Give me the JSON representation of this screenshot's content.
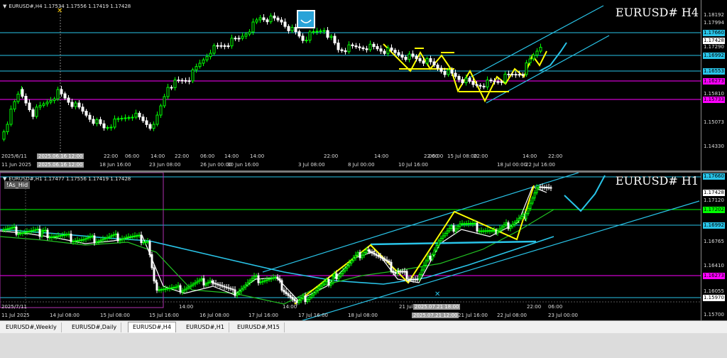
{
  "top": {
    "header": "EURUSD#,H4  1.17534 1.17556 1.17419 1.17428",
    "symbol": "EURUSD#  H4",
    "crosshair_label": "2025.06.16 12:00",
    "corner_date": "2025/6/11",
    "prices": [
      "1.18192",
      "1.17994",
      "1.17660",
      "1.17428",
      "1.17290",
      "1.16992",
      "1.16553",
      "1.16273",
      "1.15810",
      "1.15733",
      "1.15073",
      "1.14330"
    ],
    "times": [
      "11 Jun 2025",
      "2025.06.16 12:00",
      "18 Jun 16:00",
      "22:00",
      "06:00",
      "14:00",
      "23 Jun 08:00",
      "22:00",
      "06:00",
      "26 Jun 00:00",
      "14:00",
      "30 Jun 16:00",
      "14:00",
      "3 Jul 08:00",
      "22:00",
      "8 Jul 00:00",
      "14:00",
      "10 Jul 16:00",
      "22:00",
      "06:00",
      "15 Jul 08:00",
      "22:00",
      "18 Jul 00:00",
      "14:00",
      "22 Jul 16:00",
      "22:00"
    ]
  },
  "bottom": {
    "header": "EURUSD#,H1  1.17477 1.17556 1.17419 1.17428",
    "symbol": "EURUSD#  H1",
    "badge": "!As_Hid",
    "corner_date": "2025/7/11",
    "crosshair_label": "2025.07.21 12:00",
    "crosshair_label2": "2025.07.21 18:00",
    "prices": [
      "1.17660",
      "1.17428",
      "1.17120",
      "1.17202",
      "1.16992",
      "1.16765",
      "1.16410",
      "1.16273",
      "1.16055",
      "1.15970",
      "1.15700"
    ],
    "times": [
      "11 Jul 2025",
      "14 Jul 08:00",
      "15 Jul 08:00",
      "15 Jul 16:00",
      "14:00",
      "16 Jul 08:00",
      "17 Jul 16:00",
      "14:00",
      "17 Jul 16:00",
      "18 Jul 08:00",
      "21 Jul 06:00",
      "22:00",
      "21 Jul 16:00",
      "22 Jul 08:00",
      "22:00",
      "23 Jul 00:00",
      "06:00"
    ]
  },
  "tabs": [
    "EURUSD#,Weekly",
    "EURUSD#,Daily",
    "EURUSD#,H4",
    "EURUSD#,H1",
    "EURUSD#,M15"
  ],
  "active_tab": "EURUSD#,H4",
  "colors": {
    "bull": "#00ff00",
    "bear": "#ffffff",
    "cyan": "#29c4e8",
    "yellow": "#ffff00",
    "magenta": "#ff00ff",
    "green_level": "#00ff00"
  }
}
